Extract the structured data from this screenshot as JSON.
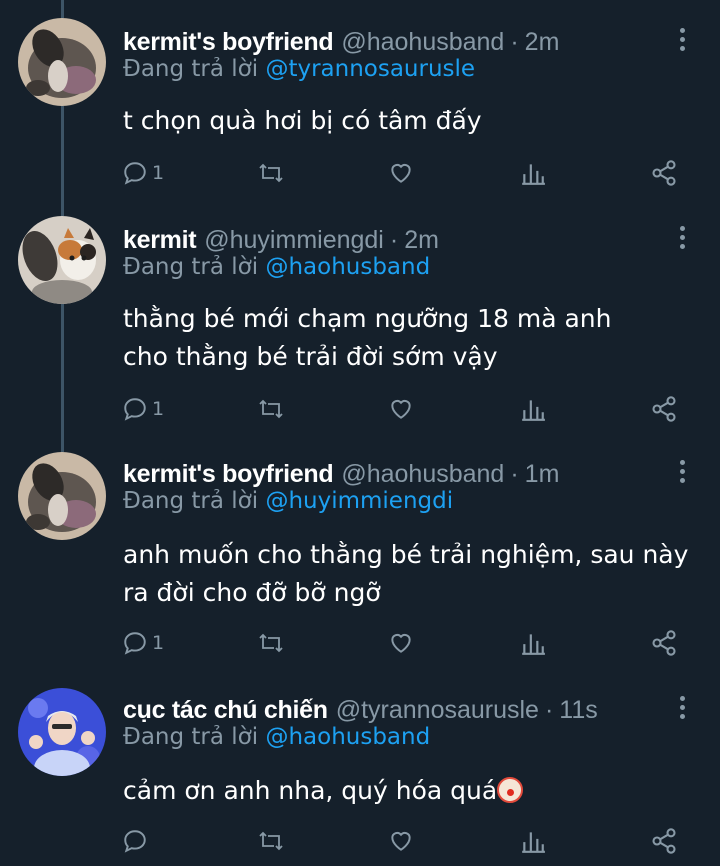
{
  "tweets": [
    {
      "name": "kermit's boyfriend",
      "handle": "@haohusband",
      "separator": "·",
      "time": "2m",
      "reply_prefix": "Đang trả lời",
      "reply_to": "@tyrannosaurusle",
      "body": "t chọn quà hơi bị có tâm đấy",
      "reply_count": "1",
      "avatar": "cat-blurry-avatar"
    },
    {
      "name": "kermit",
      "handle": "@huyimmiengdi",
      "separator": "·",
      "time": "2m",
      "reply_prefix": "Đang trả lời",
      "reply_to": "@haohusband",
      "body": "thằng bé mới chạm ngưỡng  18 mà anh cho thằng bé trải đời sớm vậy",
      "reply_count": "1",
      "avatar": "calico-cat-avatar"
    },
    {
      "name": "kermit's boyfriend",
      "handle": "@haohusband",
      "separator": "·",
      "time": "1m",
      "reply_prefix": "Đang trả lời",
      "reply_to": "@huyimmiengdi",
      "body": "anh muốn cho thằng bé trải nghiệm, sau này ra đời cho đỡ bỡ ngỡ",
      "reply_count": "1",
      "avatar": "cat-blurry-avatar"
    },
    {
      "name": "cục tác chú chiến",
      "handle": "@tyrannosaurusle",
      "separator": "·",
      "time": "11s",
      "reply_prefix": "Đang trả lời",
      "reply_to": "@haohusband",
      "body": "cảm ơn anh nha, quý hóa quá",
      "body_emoji": "clown-face-emoji",
      "reply_count": "",
      "avatar": "person-blue-avatar"
    }
  ],
  "icons": {
    "reply": "reply-icon",
    "retweet": "retweet-icon",
    "like": "heart-icon",
    "analytics": "analytics-icon",
    "share": "share-icon",
    "more": "more-vertical-icon"
  },
  "colors": {
    "background": "#15202b",
    "secondary_text": "#8899a6",
    "mention": "#1da1f2",
    "thread_line": "#3d5466"
  }
}
